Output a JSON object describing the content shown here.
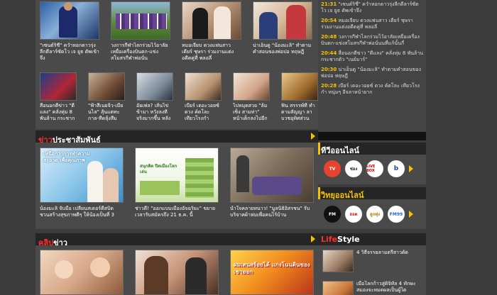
{
  "top_grid": {
    "big": [
      {
        "caption": "\"เซนต์ริชี่\" ควำหอกดาวรุ่งลีกดีลาร์ซัตโว เจ ยูธ ตัพเข้าจึง"
      },
      {
        "caption": "วงการกีฬาไลกร่วมไว้อาลัยเหยื่อเครื่องบินตก-แข่งสโมสรกีฬาพ่อนั่น"
      },
      {
        "caption": "หมอเจียบ ดวงแฟนสาว เดียร์ ชุษรา ร่วมงานแต่งอดีตคู่ที่ พลอลี่"
      },
      {
        "caption": "น่าเอ็นดู \"น้องมะลิ\" ทำตามคำสอนของพ่อปอ ทฤษฎี"
      }
    ],
    "small": [
      {
        "caption": "สื่อนอกตีข่าว \"ดี แลง\" คลั่งทุ่ม 8 พันล้าน กระชาก"
      },
      {
        "caption": "\"ฟ้าสีเนยจิ๊ว-เมียนไล\" สุ้นแตทะกาล-ทีดลุ้งสีม"
      },
      {
        "caption": "อัยเพ่ล? เส้นไข่ข้ามา หวังลงทีจริงมากขึ้น หลัง"
      },
      {
        "caption": "เบียร์ เดอะวอยซ์ ดวง ค์ตโละ เทียวโรงกำ"
      },
      {
        "caption": "ไปหมุดสวย \"ล้มเซ็ง สามท่า\" หน้าเด็กลงไปอีก"
      },
      {
        "caption": "ฟิน สรรรพ์ที่ ทำตามสัญญา ลา บวชอุทิศส่วน"
      }
    ]
  },
  "sections": {
    "pr": {
      "title_red": "ข่าว",
      "title_white": "ประชาสัมพันธ์"
    },
    "clip": {
      "title_red": "คลิป",
      "title_white": "ข่าว"
    }
  },
  "pr_items": [
    {
      "caption": "น้องมะลิ จับมือ เปลี่ยนสเตอร์ดีสบิด ชวนสร้างสุขภาพดีๆ ให้น้องเป็นที่ 3"
    },
    {
      "caption": "ช่าวดี! \"ออกแบบเมืองอัจฉริยะ\" ขยายเวลารับสมัครถึง 21 ธ.ค. นี้"
    },
    {
      "caption": "น้ำใจคลายหนาว! \"มูลนิธิอิสรชน\" รับบริจาคผ้าห่มเพื่อคนไร้บ้าน"
    }
  ],
  "pr_banner_text": "เหนือกว่าการทำความสะอาด เพื่อคุณภาพ",
  "pr_green_text": "สนุกคิด ปิดเมืองโลกเล่น",
  "clip_banner_text": "ผมเสนสร้อยได้ แกงโนนดินของเขาออก",
  "news": [
    {
      "time": "21:31",
      "text": "\"เซนต์ริชี่\" ควำหอกดาวรุ่งลีกดีลาร์ซัตโว เจ ยูธ ตัพเข้าจึง"
    },
    {
      "time": "20:54",
      "text": "หมอเจียบ ดวงแฟนสาว เดียร์ ชุษรา ร่วมงานแต่งอดีตคู่ที่ พลอลี่"
    },
    {
      "time": "20:48",
      "text": "วงการกีฬาไลกร่วมไว้อาลัยเหยื่อเครื่องบินตก-แข่งสโมสรกีฬาพ่อนั่นนที่แก้นั้นกี่"
    },
    {
      "time": "20:44",
      "text": "สื่อนอกตีข่าว \"ดีแลง\" คลั่งทุ่ม 8 พันล้านกระชากตัว \"เนย์มาร์\""
    },
    {
      "time": "20:30",
      "text": "น่าเอ็นดู \"น้องมะลิ\" ทำตามคำสอนของพ่อปอ ทฤษฎี"
    },
    {
      "time": "20:28",
      "text": "เบียร์ เดอะวอยซ์ ดวง ค์ตโละ เทียวโรงกำ หนุ่มๆ อีจลาหน้ายาก"
    }
  ],
  "tv": {
    "title": "ทีวีออนไลน์",
    "logos": [
      "TV",
      "ช่อง",
      "LIVE BOX",
      "b"
    ]
  },
  "radio": {
    "title": "วิทยุออนไลน์",
    "logos": [
      "FM",
      "ฮอต",
      "ลูกทุ่ง",
      "FM99"
    ]
  },
  "lifestyle": {
    "title_red": "Life",
    "title_white": "Style",
    "items": [
      {
        "caption": "4 วิธีจรรยลามตรีสาวดัด"
      },
      {
        "caption": "เมื่อโลกก้าวสู่ดิจิทัล 4 ทักษะสมองจะหมดผลเป็นผู้ไต"
      }
    ]
  },
  "colors": {
    "accent": "#f4c400",
    "red": "#ff2d2d",
    "bg": "#3c3c3c"
  }
}
